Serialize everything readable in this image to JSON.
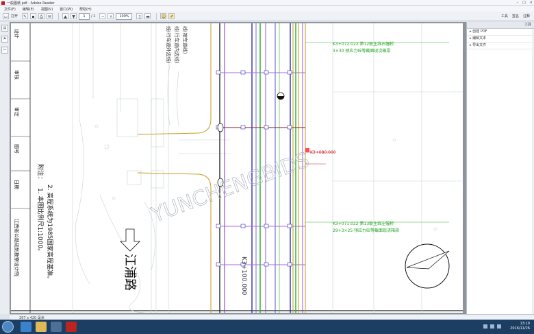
{
  "window": {
    "title": "一般图纸.pdf - Adobe Reader",
    "controls": [
      "–",
      "□",
      "×"
    ]
  },
  "menu": [
    "文件(F)",
    "编辑(E)",
    "视图(V)",
    "窗口(W)",
    "帮助(H)"
  ],
  "toolbar": {
    "open_label": "打开",
    "page_current": "1",
    "page_total": "/ 1",
    "zoom": "100%",
    "tools_label": "工具",
    "sign_label": "签名",
    "comment_label": "注释"
  },
  "right_pane": {
    "header": "工具",
    "items": [
      "创建 PDF",
      "编辑文本",
      "导出文件"
    ]
  },
  "status": {
    "size": "297 x 420 毫米"
  },
  "drawing": {
    "left_labels": [
      "设计",
      "审核",
      "审定",
      "图号",
      "日期",
      "江西省公路规划勘察设计院"
    ],
    "note_title": "附注：",
    "note_1": "1. 本图比例尺1:1000。",
    "note_2": "2. 高程系统为1985国家高程基准。",
    "road_name": "江浦路",
    "station_main": "K3+100.000",
    "station_mid": "K3+080.000",
    "anno_top_1": "K3+072.022  第12联主线右幅桥",
    "anno_top_2": "3×30  预应力砼等截面现浇箱梁",
    "anno_bot_1": "K3+071.022  第13联主线左幅桥",
    "anno_bot_2": "29+3×25  预应力砼等截面现浇箱梁",
    "rot_labels": [
      "线(按车道线)",
      "线(行车道内边线)",
      "线(行车道外边线)"
    ],
    "watermark": "YUNCHENGBIDS"
  },
  "taskbar": {
    "time": "13:10",
    "date": "2016/11/26"
  }
}
